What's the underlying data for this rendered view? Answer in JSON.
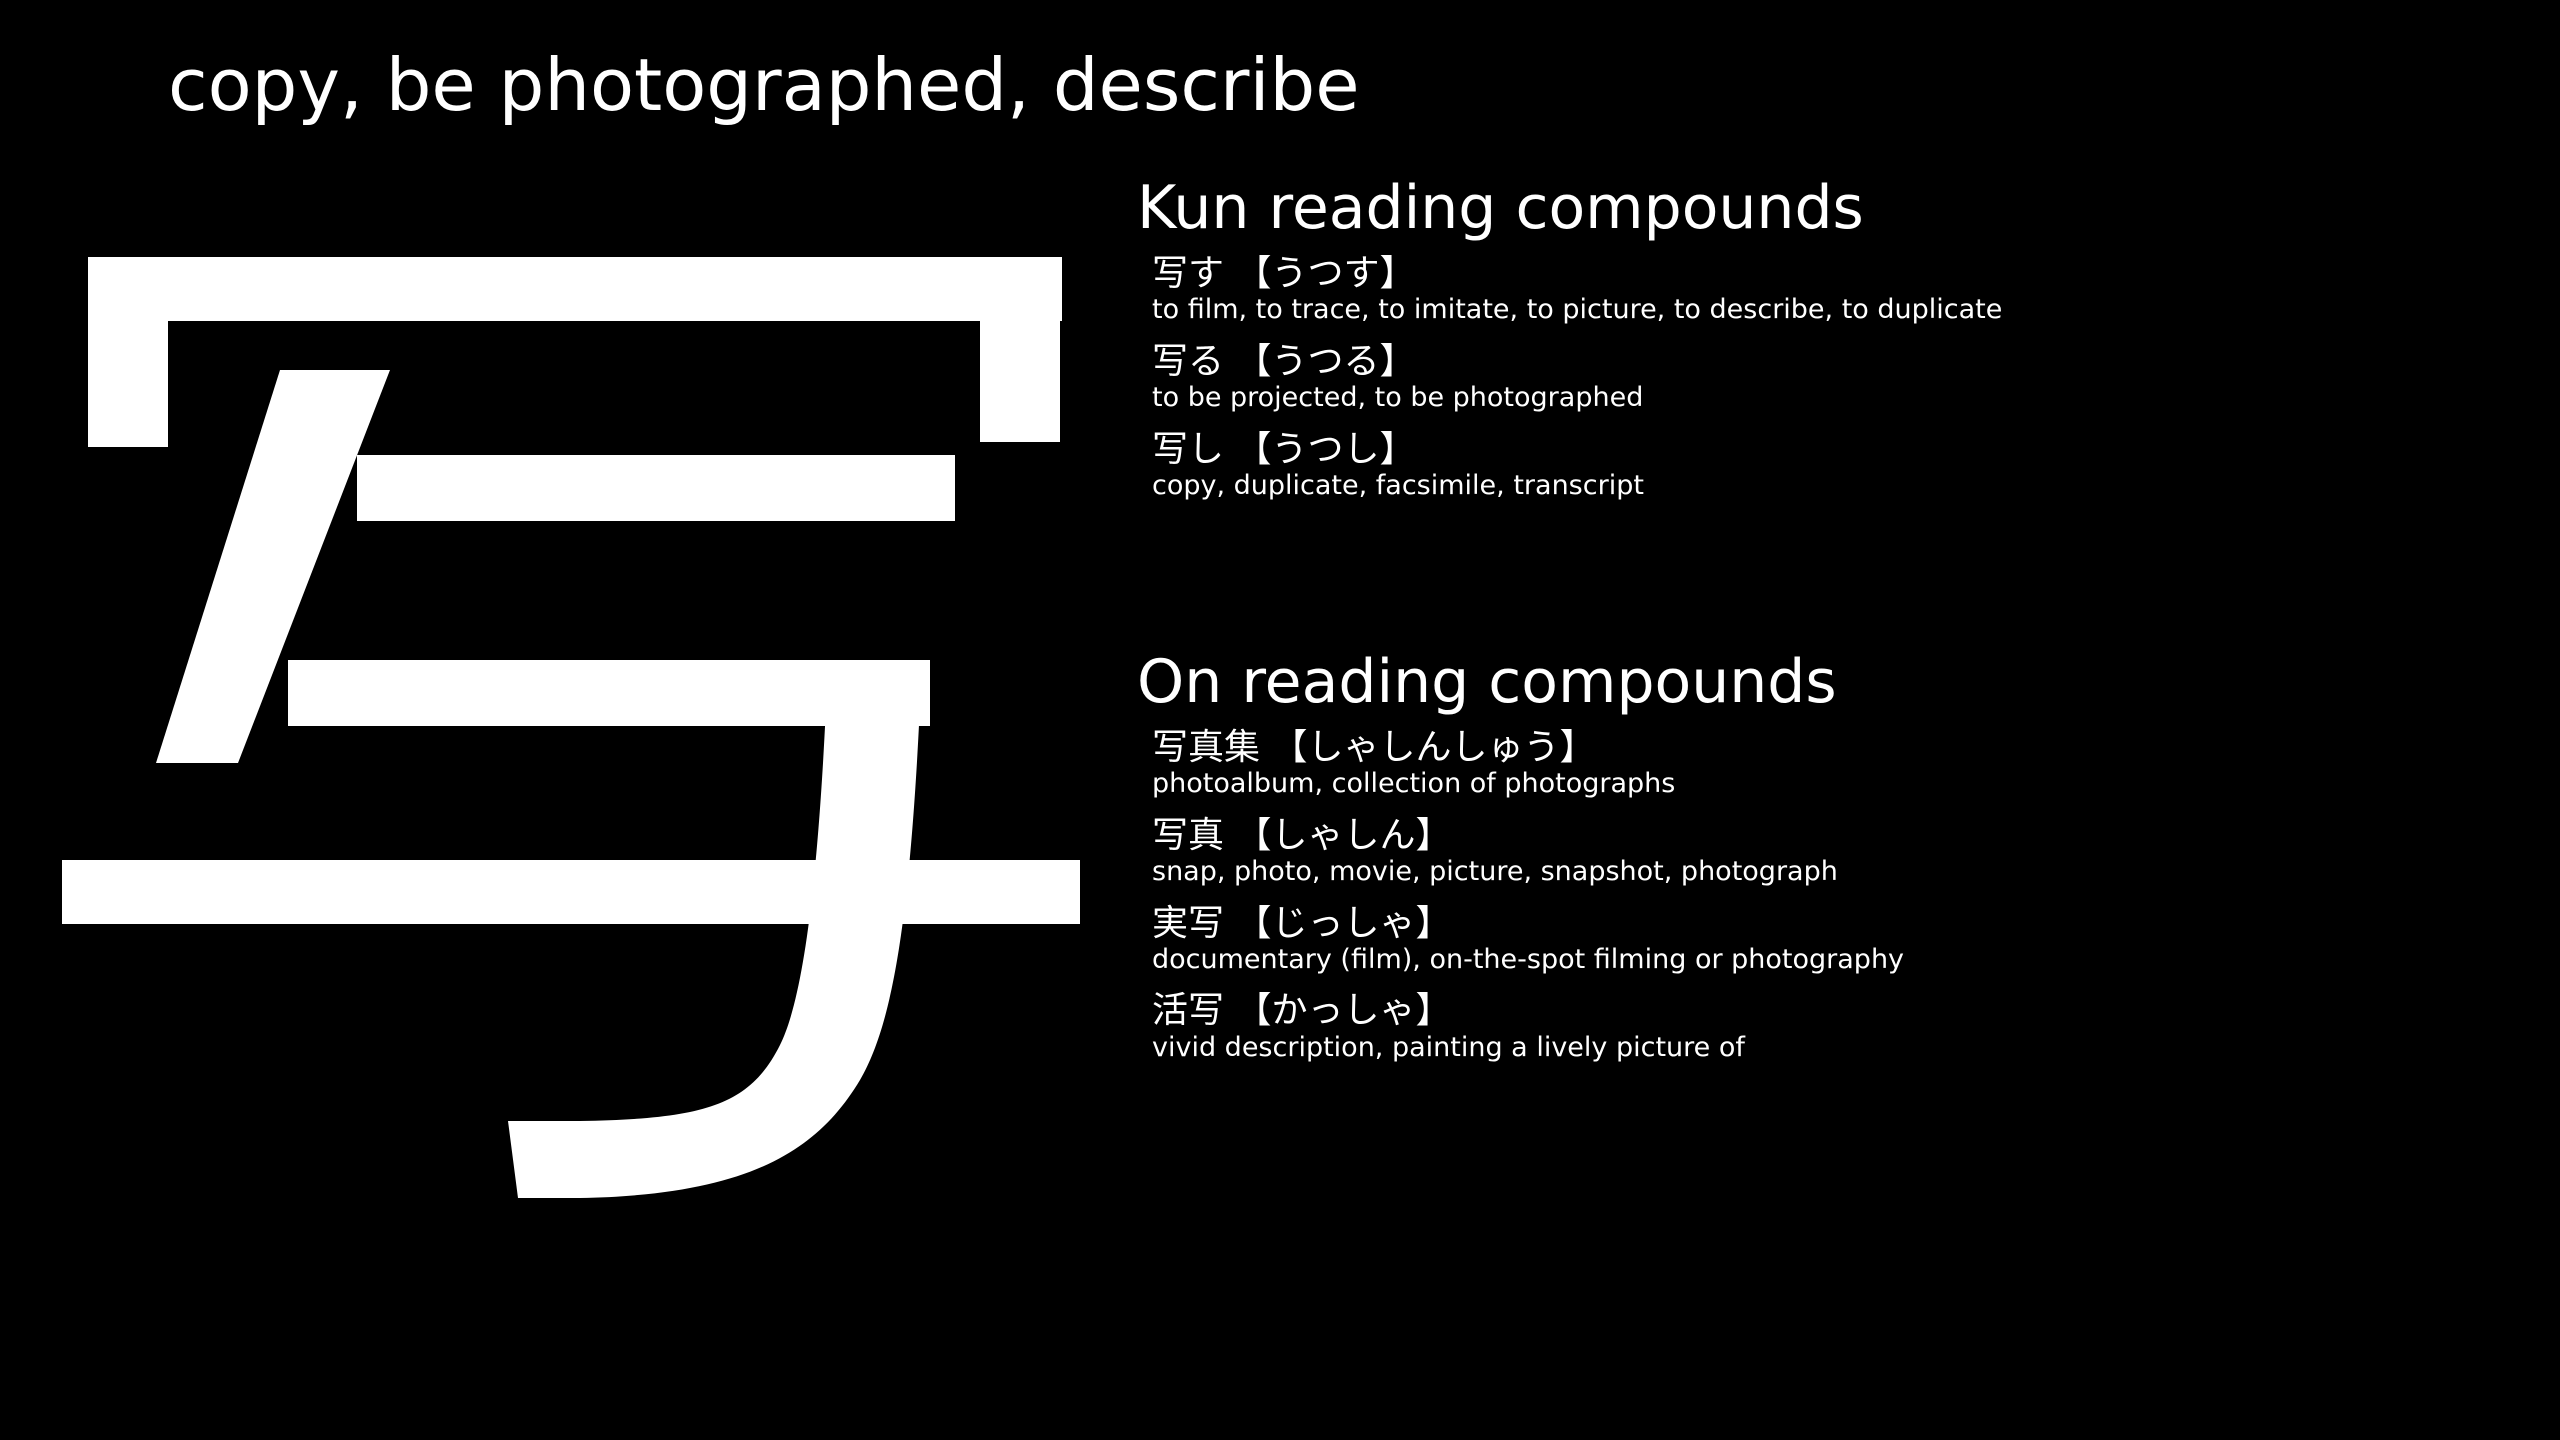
{
  "meaning": "copy, be photographed, describe",
  "kanji": "写",
  "colors": {
    "background": "#000000",
    "foreground": "#ffffff"
  },
  "kun": {
    "heading": "Kun reading compounds",
    "entries": [
      {
        "word": "写す 【うつす】",
        "gloss": "to film, to trace, to imitate, to picture, to describe, to duplicate"
      },
      {
        "word": "写る 【うつる】",
        "gloss": "to be projected, to be photographed"
      },
      {
        "word": "写し 【うつし】",
        "gloss": "copy, duplicate, facsimile, transcript"
      }
    ]
  },
  "on": {
    "heading": "On reading compounds",
    "entries": [
      {
        "word": "写真集 【しゃしんしゅう】",
        "gloss": "photoalbum, collection of photographs"
      },
      {
        "word": "写真 【しゃしん】",
        "gloss": "snap, photo, movie, picture, snapshot, photograph"
      },
      {
        "word": "実写 【じっしゃ】",
        "gloss": "documentary (film), on-the-spot filming or photography"
      },
      {
        "word": "活写 【かっしゃ】",
        "gloss": "vivid description, painting a lively picture of"
      }
    ]
  }
}
